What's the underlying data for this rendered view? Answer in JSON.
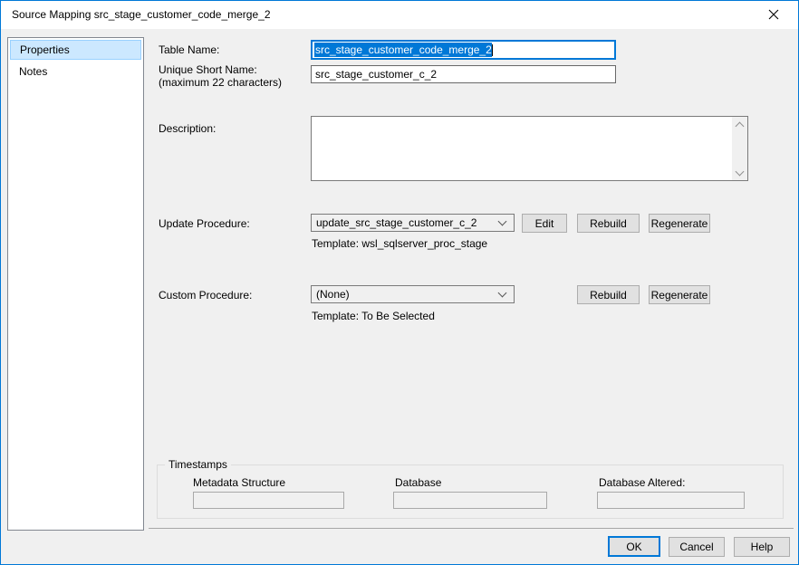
{
  "window": {
    "title": "Source Mapping src_stage_customer_code_merge_2"
  },
  "icons": {
    "close_icon": "✕",
    "chevron_down_icon": "∨",
    "scrollbar_up_icon": "∧",
    "scrollbar_down_icon": "∨"
  },
  "sidebar": {
    "items": [
      {
        "label": "Properties",
        "selected": true
      },
      {
        "label": "Notes",
        "selected": false
      }
    ]
  },
  "form": {
    "table_name_label": "Table Name:",
    "table_name_value": "src_stage_customer_code_merge_2",
    "unique_short_name_label": "Unique Short Name:",
    "unique_short_name_hint": "(maximum 22 characters)",
    "unique_short_name_value": "src_stage_customer_c_2",
    "description_label": "Description:",
    "description_value": "",
    "update_procedure_label": "Update Procedure:",
    "update_procedure_value": "update_src_stage_customer_c_2",
    "update_procedure_template": "Template: wsl_sqlserver_proc_stage",
    "edit_button": "Edit",
    "rebuild_button": "Rebuild",
    "regenerate_button": "Regenerate",
    "custom_procedure_label": "Custom Procedure:",
    "custom_procedure_value": "(None)",
    "custom_procedure_template": "Template: To Be Selected"
  },
  "timestamps": {
    "group_label": "Timestamps",
    "metadata_structure_label": "Metadata Structure",
    "metadata_structure_value": "",
    "database_label": "Database",
    "database_value": "",
    "database_altered_label": "Database Altered:",
    "database_altered_value": ""
  },
  "footer": {
    "ok_button": "OK",
    "cancel_button": "Cancel",
    "help_button": "Help"
  },
  "colors": {
    "accent": "#0078d7",
    "titlebar_bg": "#ffffff",
    "dialog_bg": "#f0f0f0",
    "selected_item_bg": "#cce8ff",
    "selected_item_border": "#99d1ff",
    "selection_bg": "#0078d7",
    "button_bg": "#e1e1e1",
    "button_border": "#adadad"
  }
}
